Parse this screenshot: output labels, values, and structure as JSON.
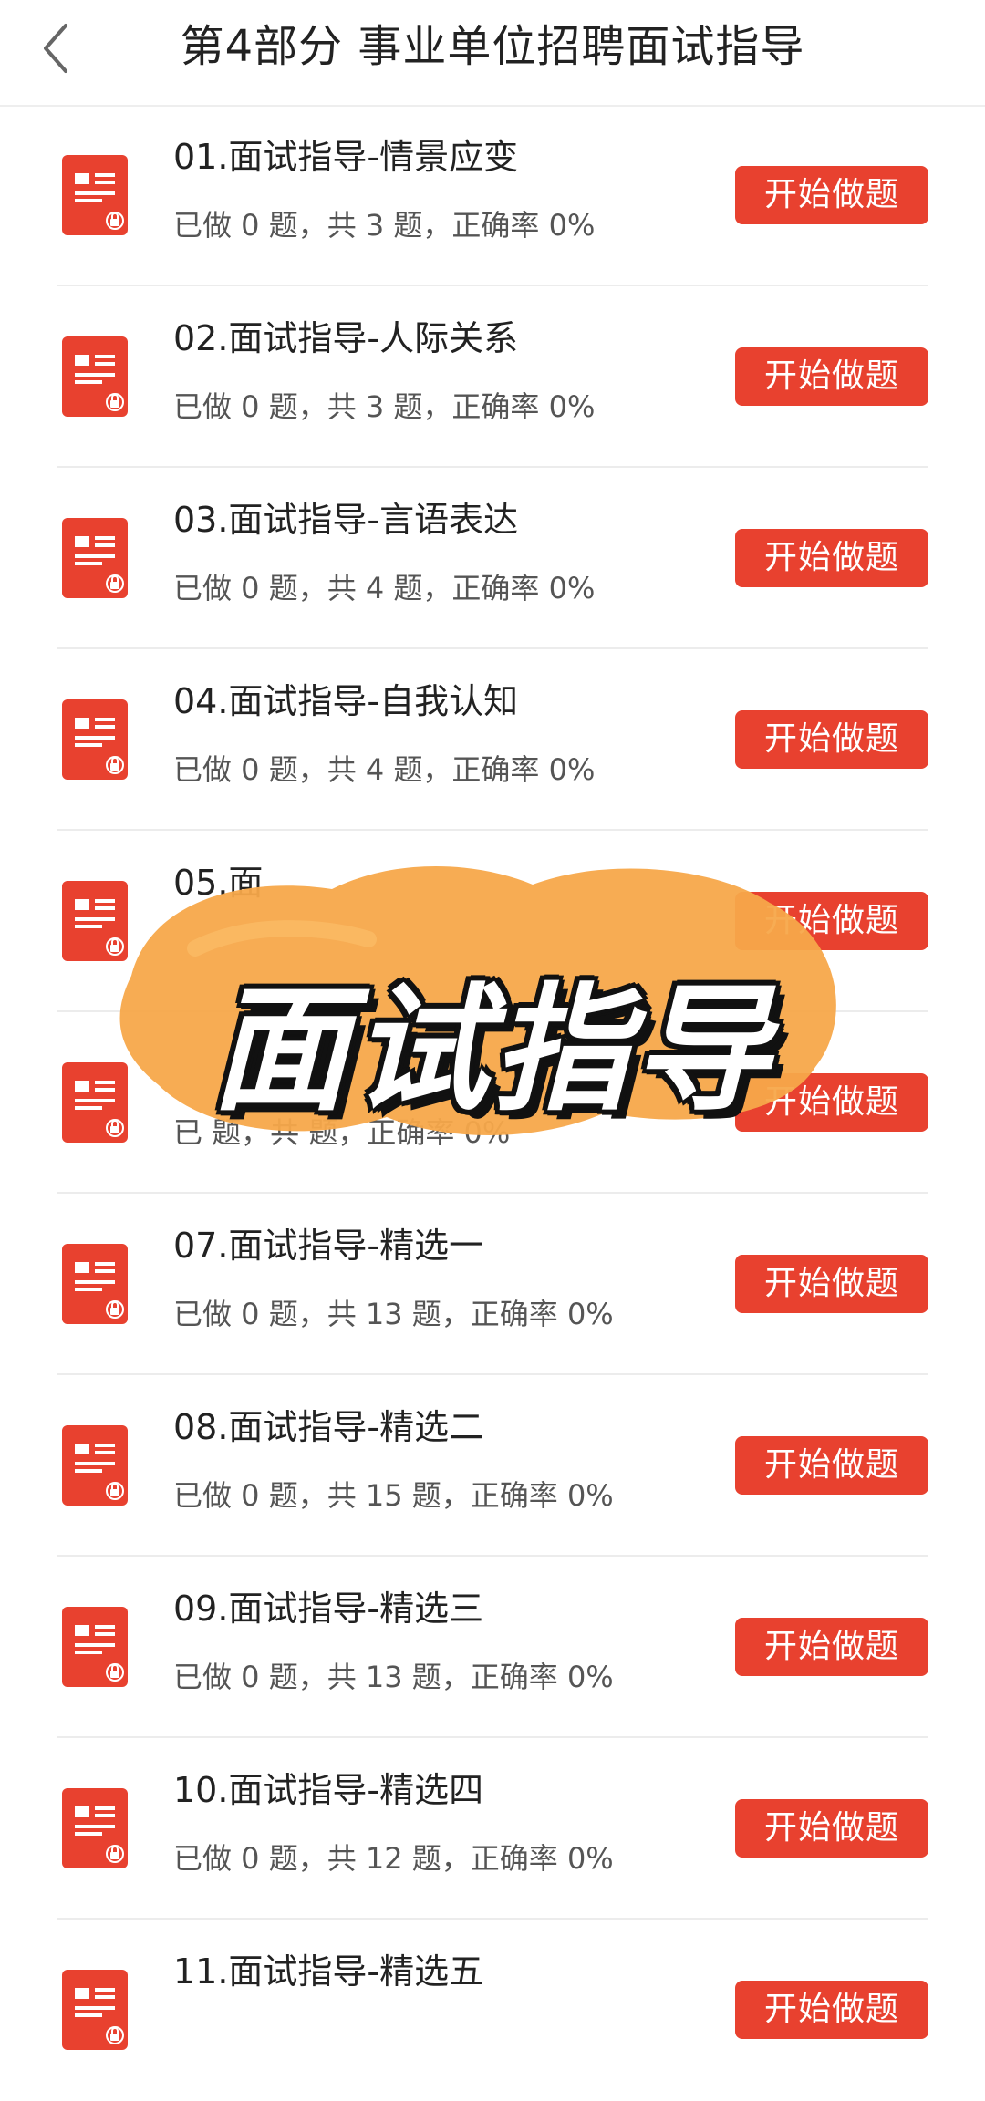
{
  "header": {
    "title": "第4部分 事业单位招聘面试指导"
  },
  "overlay": {
    "sticker_text": "面试指导",
    "sticker_color": "#f7a84a"
  },
  "button_label": "开始做题",
  "colors": {
    "accent": "#e8412f",
    "icon_red": "#e8412f"
  },
  "items": [
    {
      "title": "01.面试指导-情景应变",
      "stats": "已做 0 题，共 3 题，正确率 0%"
    },
    {
      "title": "02.面试指导-人际关系",
      "stats": "已做 0 题，共 3 题，正确率 0%"
    },
    {
      "title": "03.面试指导-言语表达",
      "stats": "已做 0 题，共 4 题，正确率 0%"
    },
    {
      "title": "04.面试指导-自我认知",
      "stats": "已做 0 题，共 4 题，正确率 0%"
    },
    {
      "title": "05.面",
      "stats": ""
    },
    {
      "title": "",
      "stats": "已  题，共  题，正确率 0%"
    },
    {
      "title": "07.面试指导-精选一",
      "stats": "已做 0 题，共 13 题，正确率 0%"
    },
    {
      "title": "08.面试指导-精选二",
      "stats": "已做 0 题，共 15 题，正确率 0%"
    },
    {
      "title": "09.面试指导-精选三",
      "stats": "已做 0 题，共 13 题，正确率 0%"
    },
    {
      "title": "10.面试指导-精选四",
      "stats": "已做 0 题，共 12 题，正确率 0%"
    },
    {
      "title": "11.面试指导-精选五",
      "stats": ""
    }
  ]
}
